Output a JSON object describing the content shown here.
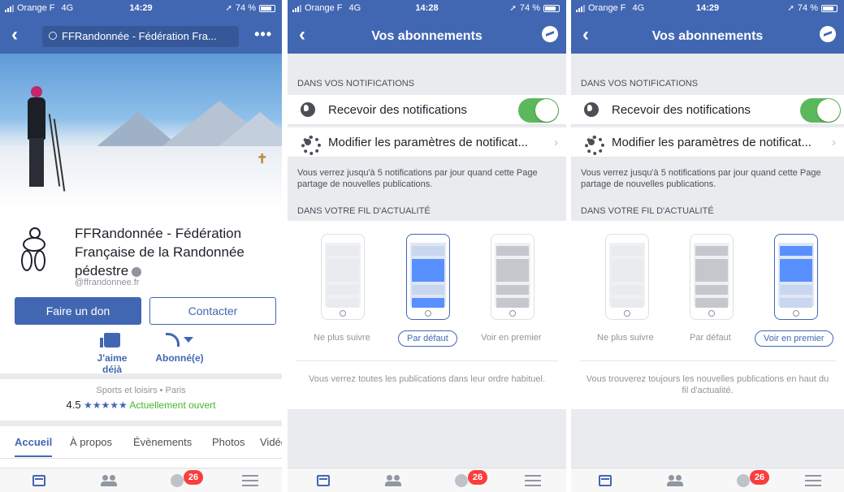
{
  "status": {
    "carrier": "Orange F",
    "network": "4G",
    "battery": "74 %",
    "time_p1": "14:29",
    "time_p2": "14:28",
    "time_p3": "14:29"
  },
  "page": {
    "search_text": "FFRandonnée - Fédération Fra...",
    "more_label": "•••",
    "name": "FFRandonnée - Fédération Française de la Randonnée pédestre",
    "handle": "@ffrandonnee.fr",
    "donate_label": "Faire un don",
    "contact_label": "Contacter",
    "like_label": "J'aime déjà",
    "follow_label": "Abonné(e)",
    "category": "Sports et loisirs",
    "location": "Paris",
    "rating_value": "4.5",
    "rating_stars": "★★★★★",
    "open_status": "Actuellement ouvert",
    "tabs": [
      "Accueil",
      "À propos",
      "Évènements",
      "Photos",
      "Vidéos"
    ]
  },
  "subscriptions": {
    "title": "Vos abonnements",
    "section_notifications": "DANS VOS NOTIFICATIONS",
    "receive_label": "Recevoir des notifications",
    "receive_enabled": true,
    "modify_label": "Modifier les paramètres de notificat...",
    "notif_note": "Vous verrez jusqu'à 5 notifications par jour quand cette Page partage de nouvelles publications.",
    "section_feed": "DANS VOTRE FIL D'ACTUALITÉ",
    "options": [
      "Ne plus suivre",
      "Par défaut",
      "Voir en premier"
    ],
    "note_default": "Vous verrez toutes les publications dans leur ordre habituel.",
    "note_first": "Vous trouverez toujours les nouvelles publications en haut du fil d'actualité."
  },
  "tabbar": {
    "notification_count": "26"
  },
  "icons": {
    "back": "chevron-left-icon",
    "search": "search-icon",
    "messenger": "messenger-icon",
    "globe": "globe-icon",
    "gear": "gear-icon",
    "like": "thumbs-up-icon",
    "follow": "rss-icon",
    "feed": "news-feed-icon",
    "friends": "friends-icon",
    "notifications": "globe-icon",
    "menu": "hamburger-icon"
  },
  "colors": {
    "brand": "#4267b2",
    "toggle_on": "#5cb85c",
    "badge": "#fa3e3e",
    "open": "#42b72a"
  }
}
